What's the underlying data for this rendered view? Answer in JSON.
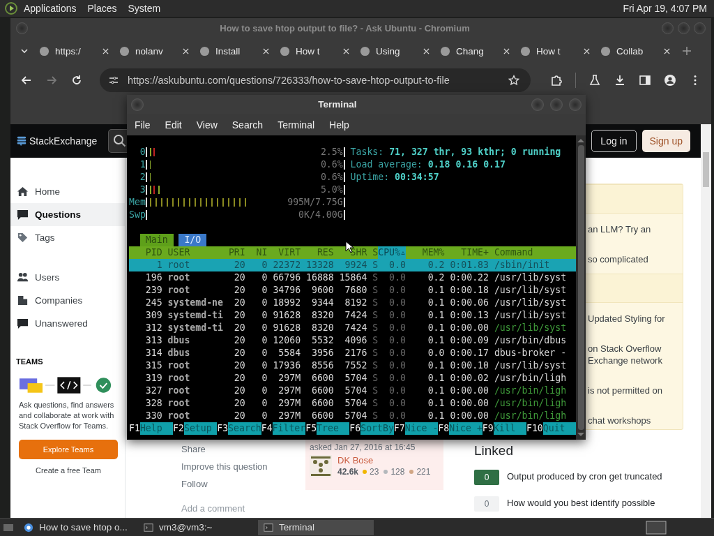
{
  "desktop_panel": {
    "menus": [
      "Applications",
      "Places",
      "System"
    ],
    "clock": "Fri Apr 19,  4:07 PM"
  },
  "browser": {
    "title": "How to save htop output to file? - Ask Ubuntu - Chromium",
    "tabs": [
      {
        "label": "https:/"
      },
      {
        "label": "nolanv"
      },
      {
        "label": "Install"
      },
      {
        "label": "How t"
      },
      {
        "label": "Using"
      },
      {
        "label": "Chang"
      },
      {
        "label": "How t"
      },
      {
        "label": "Collab"
      }
    ],
    "url": "https://askubuntu.com/questions/726333/how-to-save-htop-output-to-file"
  },
  "page": {
    "logo": "StackExchange",
    "login": "Log in",
    "signup": "Sign up",
    "nav_groups": [
      [
        {
          "label": "Home",
          "kind": "home",
          "selected": false
        },
        {
          "label": "Questions",
          "kind": "questions",
          "selected": true
        },
        {
          "label": "Tags",
          "kind": "tag",
          "selected": false
        }
      ],
      [
        {
          "label": "Users",
          "kind": "users",
          "selected": false
        },
        {
          "label": "Companies",
          "kind": "building",
          "selected": false
        },
        {
          "label": "Unanswered",
          "kind": "unanswered",
          "selected": false
        }
      ]
    ],
    "teams": {
      "heading": "TEAMS",
      "text": "Ask questions, find answers and collaborate at work with Stack Overflow for Teams.",
      "button": "Explore Teams",
      "link": "Create a free Team"
    },
    "post_menu": [
      "Share",
      "Improve this question",
      "Follow"
    ],
    "add_comment": "Add a comment",
    "asked": "asked Jan 27, 2016 at 16:45",
    "user": {
      "name": "DK Bose",
      "reputation": "42.6k",
      "badges": [
        {
          "count": "23",
          "color": "#f1b600"
        },
        {
          "count": "128",
          "color": "#b4b8bc"
        },
        {
          "count": "221",
          "color": "#d1a684"
        }
      ]
    },
    "blog_sections": [
      [
        {
          "lines": [
            "an LLM? Try an"
          ]
        },
        {
          "lines": [
            "so complicated"
          ]
        }
      ],
      [
        {
          "lines": [
            "Updated Styling for"
          ]
        },
        {
          "lines": [
            "on Stack Overflow",
            "Exchange network"
          ]
        },
        {
          "lines": [
            "is not permitted on"
          ]
        },
        {
          "lines": [
            "chat workshops"
          ]
        }
      ]
    ],
    "linked": {
      "heading": "Linked",
      "items": [
        {
          "score": "0",
          "answered": true,
          "title": "Output produced by cron get truncated"
        },
        {
          "score": "0",
          "answered": false,
          "title": "How would you best identify possible"
        }
      ]
    }
  },
  "terminal": {
    "title": "Terminal",
    "menu": [
      "File",
      "Edit",
      "View",
      "Search",
      "Terminal",
      "Help"
    ],
    "meters": [
      {
        "label": "0",
        "kind": "cpu",
        "level": 0.04,
        "reading": "2.5%"
      },
      {
        "label": "1",
        "kind": "cpu",
        "level": 0.015,
        "reading": "0.6%"
      },
      {
        "label": "2",
        "kind": "cpu",
        "level": 0.015,
        "reading": "0.6%"
      },
      {
        "label": "3",
        "kind": "cpu",
        "level": 0.07,
        "reading": "5.0%"
      },
      {
        "label": "Mem",
        "kind": "memory",
        "level": 0.52,
        "reading": "995M/7.75G"
      },
      {
        "label": "Swp",
        "kind": "swap",
        "level": 0,
        "reading": "0K/4.00G"
      }
    ],
    "info": [
      {
        "label": "Tasks:",
        "value": "71, 327 thr, 93 kthr; 0 running"
      },
      {
        "label": "Load average:",
        "value": "0.18 0.16 0.17"
      },
      {
        "label": "Uptime:",
        "value": "00:34:57"
      }
    ],
    "tabs": [
      {
        "label": "Main",
        "selected": true
      },
      {
        "label": "I/O",
        "selected": false
      }
    ],
    "columns": [
      {
        "label": "PID",
        "selected": false
      },
      {
        "label": "USER",
        "selected": false
      },
      {
        "label": "PRI",
        "selected": false
      },
      {
        "label": "NI",
        "selected": false
      },
      {
        "label": "VIRT",
        "selected": false
      },
      {
        "label": "RES",
        "selected": false
      },
      {
        "label": "SHR",
        "selected": false
      },
      {
        "label": "S",
        "selected": false
      },
      {
        "label": "CPU%▵",
        "selected": true
      },
      {
        "label": "MEM%",
        "selected": false
      },
      {
        "label": "TIME+",
        "selected": false
      },
      {
        "label": "Command",
        "selected": false
      }
    ],
    "rows": [
      {
        "cells": [
          "1",
          "root",
          "20",
          "0",
          "22372",
          "13328",
          "9924",
          "S",
          "0.0",
          "0.2",
          "0:01.83",
          "/sbin/init"
        ],
        "selected": true,
        "thread": false
      },
      {
        "cells": [
          "196",
          "root",
          "20",
          "0",
          "66796",
          "16888",
          "15864",
          "S",
          "0.0",
          "0.2",
          "0:00.22",
          "/usr/lib/syst"
        ],
        "selected": false,
        "thread": false
      },
      {
        "cells": [
          "239",
          "root",
          "20",
          "0",
          "34796",
          "9600",
          "7680",
          "S",
          "0.0",
          "0.1",
          "0:00.18",
          "/usr/lib/syst"
        ],
        "selected": false,
        "thread": false
      },
      {
        "cells": [
          "245",
          "systemd-ne",
          "20",
          "0",
          "18992",
          "9344",
          "8192",
          "S",
          "0.0",
          "0.1",
          "0:00.06",
          "/usr/lib/syst"
        ],
        "selected": false,
        "thread": false
      },
      {
        "cells": [
          "309",
          "systemd-ti",
          "20",
          "0",
          "91628",
          "8320",
          "7424",
          "S",
          "0.0",
          "0.1",
          "0:00.13",
          "/usr/lib/syst"
        ],
        "selected": false,
        "thread": false
      },
      {
        "cells": [
          "312",
          "systemd-ti",
          "20",
          "0",
          "91628",
          "8320",
          "7424",
          "S",
          "0.0",
          "0.1",
          "0:00.00",
          "/usr/lib/syst"
        ],
        "selected": false,
        "thread": true
      },
      {
        "cells": [
          "313",
          "dbus",
          "20",
          "0",
          "12060",
          "5532",
          "4096",
          "S",
          "0.0",
          "0.1",
          "0:00.09",
          "/usr/bin/dbus"
        ],
        "selected": false,
        "thread": false
      },
      {
        "cells": [
          "314",
          "dbus",
          "20",
          "0",
          "5584",
          "3956",
          "2176",
          "S",
          "0.0",
          "0.0",
          "0:00.17",
          "dbus-broker -"
        ],
        "selected": false,
        "thread": false
      },
      {
        "cells": [
          "315",
          "root",
          "20",
          "0",
          "17936",
          "8556",
          "7552",
          "S",
          "0.0",
          "0.1",
          "0:00.10",
          "/usr/lib/syst"
        ],
        "selected": false,
        "thread": false
      },
      {
        "cells": [
          "319",
          "root",
          "20",
          "0",
          "297M",
          "6600",
          "5704",
          "S",
          "0.0",
          "0.1",
          "0:00.02",
          "/usr/bin/ligh"
        ],
        "selected": false,
        "thread": false
      },
      {
        "cells": [
          "327",
          "root",
          "20",
          "0",
          "297M",
          "6600",
          "5704",
          "S",
          "0.0",
          "0.1",
          "0:00.00",
          "/usr/bin/ligh"
        ],
        "selected": false,
        "thread": true
      },
      {
        "cells": [
          "328",
          "root",
          "20",
          "0",
          "297M",
          "6600",
          "5704",
          "S",
          "0.0",
          "0.1",
          "0:00.00",
          "/usr/bin/ligh"
        ],
        "selected": false,
        "thread": true
      },
      {
        "cells": [
          "330",
          "root",
          "20",
          "0",
          "297M",
          "6600",
          "5704",
          "S",
          "0.0",
          "0.1",
          "0:00.00",
          "/usr/bin/ligh"
        ],
        "selected": false,
        "thread": true
      }
    ],
    "function_keys": [
      {
        "key": "F1",
        "label": "Help"
      },
      {
        "key": "F2",
        "label": "Setup"
      },
      {
        "key": "F3",
        "label": "Search"
      },
      {
        "key": "F4",
        "label": "Filter"
      },
      {
        "key": "F5",
        "label": "Tree"
      },
      {
        "key": "F6",
        "label": "SortBy"
      },
      {
        "key": "F7",
        "label": "Nice -"
      },
      {
        "key": "F8",
        "label": "Nice +"
      },
      {
        "key": "F9",
        "label": "Kill"
      },
      {
        "key": "F10",
        "label": "Quit"
      }
    ]
  },
  "taskbar": {
    "items": [
      {
        "label": "How to save htop o...",
        "kind": "browser",
        "active": false
      },
      {
        "label": "vm3@vm3:~",
        "kind": "terminal",
        "active": false
      },
      {
        "label": "Terminal",
        "kind": "terminal",
        "active": true
      }
    ]
  }
}
